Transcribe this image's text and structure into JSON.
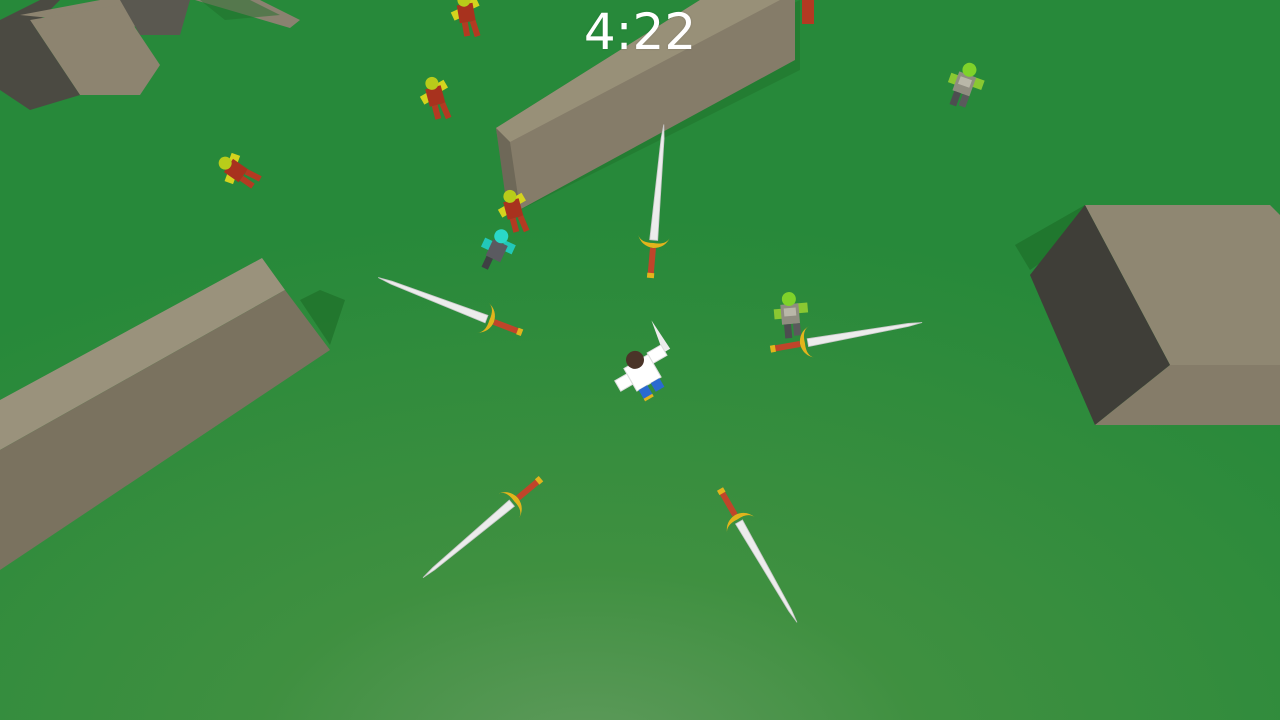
{
  "hud": {
    "timer": "4:22"
  },
  "colors": {
    "ground": "#2a8a35",
    "ground_light": "#5a9a58",
    "wall_top": "#8d8470",
    "wall_side": "#4b4a42",
    "blade": "#e8e8e8",
    "guard": "#e0b21a",
    "grip": "#c0452a",
    "enemy_body": "#a8321e",
    "enemy_limb": "#c8c81e",
    "enemy_head": "#b2c81a",
    "armored_body": "#8a8a80",
    "armored_limb": "#8ac832",
    "cyan_enemy": "#22c8b8",
    "player_body": "#ffffff",
    "player_hair": "#4a3428",
    "player_legs": "#2a6ad0"
  },
  "icons": {
    "sword": "sword-icon",
    "enemy": "zombie-icon",
    "player": "player-icon"
  }
}
